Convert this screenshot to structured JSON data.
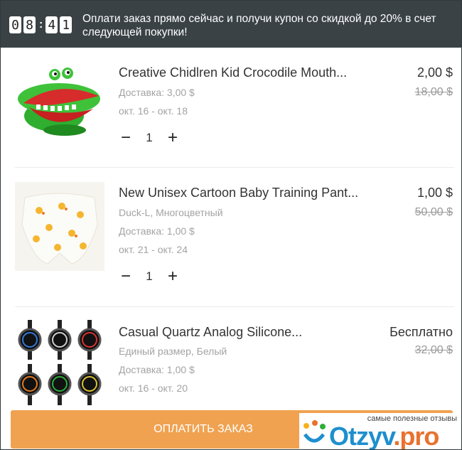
{
  "banner": {
    "timer_digits": [
      "0",
      "8",
      "4",
      "1"
    ],
    "message": "Оплати заказ прямо сейчас и получи купон со скидкой до 20% в счет следующей покупки!"
  },
  "items": [
    {
      "title": "Creative Chidlren Kid Crocodile Mouth...",
      "variant": "",
      "shipping": "Доставка: 3,00 $",
      "dates": "окт. 16 - окт. 18",
      "price": "2,00 $",
      "old_price": "18,00 $",
      "quantity": "1",
      "image": "crocodile-toy"
    },
    {
      "title": " New Unisex Cartoon Baby Training Pant...",
      "variant": "Duck-L, Многоцветный",
      "shipping": "Доставка: 1,00 $",
      "dates": "окт. 21 - окт. 24",
      "price": "1,00 $",
      "old_price": "50,00 $",
      "quantity": "1",
      "image": "baby-training-pants"
    },
    {
      "title": "Casual Quartz Analog Silicone...",
      "variant": "Единый размер, Белый",
      "shipping": "Доставка: 1,00 $",
      "dates": "окт. 16 - окт. 20",
      "price": "Бесплатно",
      "old_price": "32,00 $"
    }
  ],
  "pay_button": "ОПЛАТИТЬ ЗАКАЗ",
  "watermark": {
    "tagline": "самые полезные отзывы",
    "logo_main": "Otzyv",
    "logo_dot": ".pro"
  },
  "colors": {
    "banner_bg": "#3a4246",
    "pay_button": "#f0a250",
    "watermark_blue": "#1e8fce"
  }
}
